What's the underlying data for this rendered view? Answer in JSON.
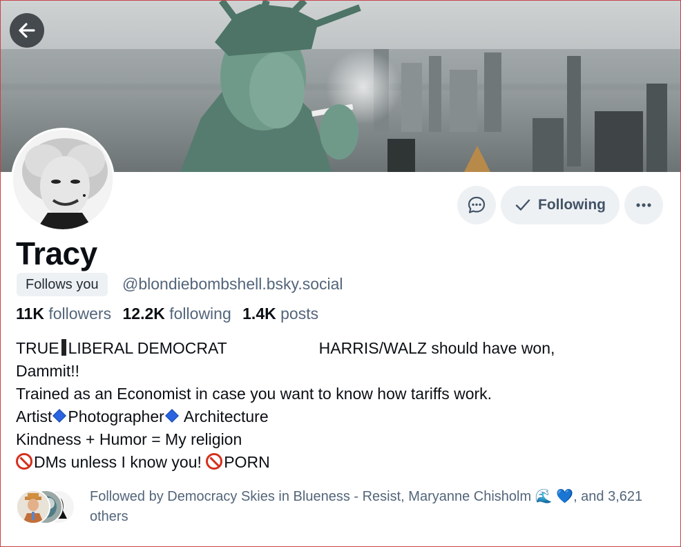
{
  "header": {
    "back_icon": "arrow-left-icon"
  },
  "profile": {
    "display_name": "Tracy",
    "follows_you_label": "Follows you",
    "handle": "@blondiebombshell.bsky.social",
    "stats": {
      "followers_count": "11K",
      "followers_label": "followers",
      "following_count": "12.2K",
      "following_label": "following",
      "posts_count": "1.4K",
      "posts_label": "posts"
    }
  },
  "actions": {
    "message_icon": "chat-bubble-icon",
    "following_label": "Following",
    "following_icon": "check-icon",
    "more_icon": "ellipsis-icon"
  },
  "bio": {
    "line1_a": "TRUE",
    "line1_b": "LIBERAL DEMOCRAT",
    "line1_c": "HARRIS/WALZ should have won,",
    "line1_d": "Dammit!!",
    "line2": "Trained as an Economist in case you want to know how tariffs work.",
    "line3_a": "Artist",
    "line3_b": "Photographer",
    "line3_c": "Architecture",
    "line4": "Kindness + Humor = My religion",
    "line5_a": "DMs unless I know you!",
    "line5_b": "PORN"
  },
  "followed_by": {
    "text": "Followed by Democracy Skies in Blueness - Resist, Maryanne Chisholm 🌊 ",
    "heart": "💙",
    "text_end": ", and 3,621 others"
  },
  "colors": {
    "accent_text": "#53657a",
    "button_bg": "#eef1f4",
    "blue_diamond": "#2a64e0",
    "no_entry_red": "#d5301d"
  }
}
